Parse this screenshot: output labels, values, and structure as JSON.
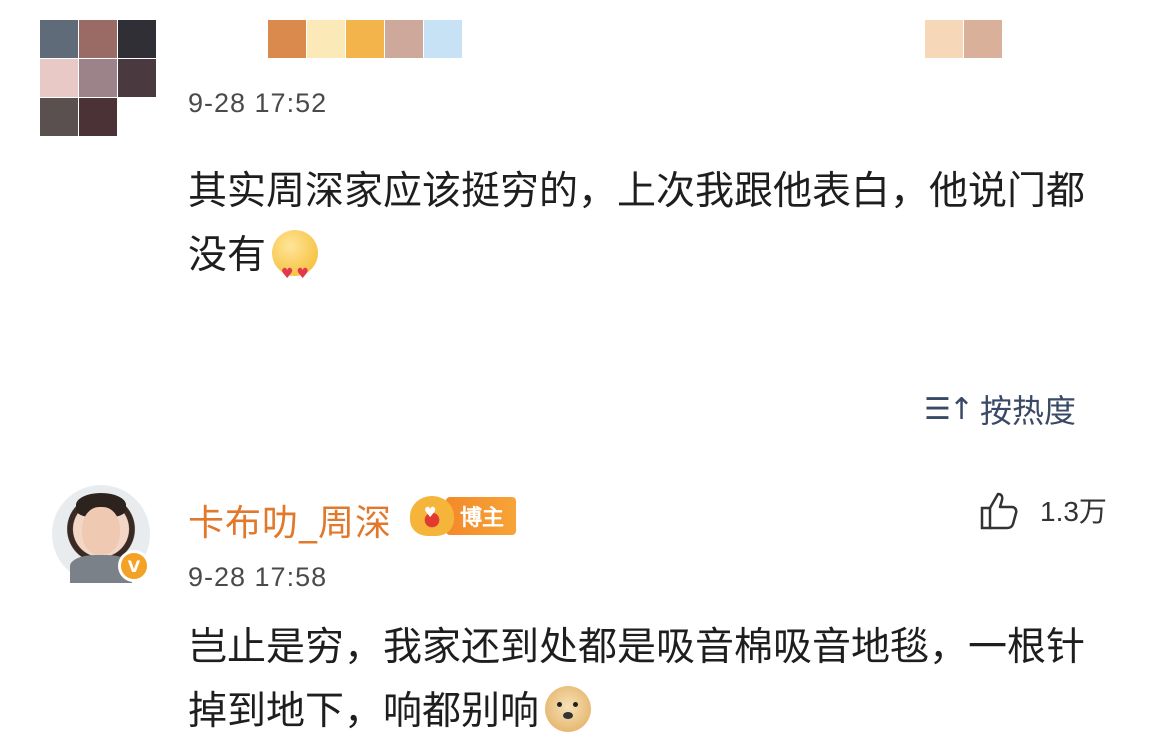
{
  "comments": [
    {
      "author": "",
      "time": "9-28 17:52",
      "text": "其实周深家应该挺穷的，上次我跟他表白，他说门都没有",
      "emoji": "heart-eyes-emoji"
    },
    {
      "author": "卡布叻_周深",
      "badge": "博主",
      "time": "9-28 17:58",
      "text": "岂止是穷，我家还到处都是吸音棉吸音地毯，一根针掉到地下，响都别响",
      "emoji": "doge-emoji",
      "likes": "1.3万"
    }
  ],
  "sort": {
    "label": "按热度",
    "icon": "sort-icon"
  },
  "colors": {
    "username": "#e2782c",
    "badge": "#f3892a",
    "sort": "#3a4a66",
    "verify": "#f3a225"
  },
  "mosaic_colors": [
    "#5f6b78",
    "#9a6a64",
    "#2f2f35",
    "#e8c9c6",
    "#9c8389",
    "#4a3a40",
    "#5a5050",
    "#4a3236",
    "#ffffff"
  ],
  "name_mosaic_colors": [
    "#d98a4c",
    "#fbeab8",
    "#f2b44b",
    "#cfa89c",
    "#c6e2f4"
  ],
  "name_mosaic_colors_2": [
    "#f6d8b8",
    "#d9b09a"
  ]
}
